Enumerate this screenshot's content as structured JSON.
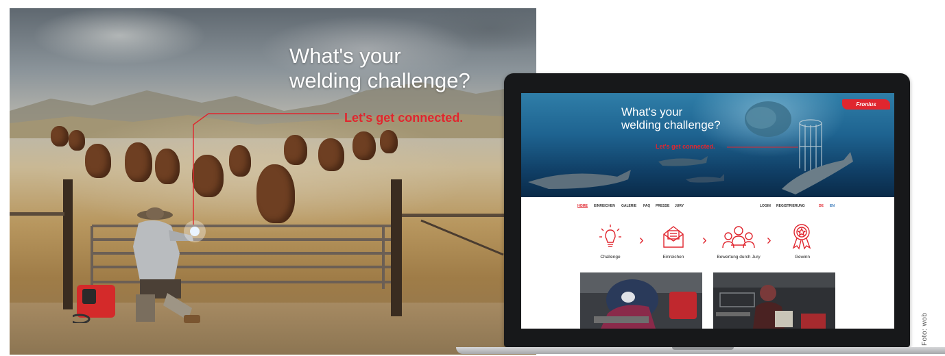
{
  "ad": {
    "headline_line1": "What's your",
    "headline_line2": "welding challenge?",
    "tagline": "Let's get connected."
  },
  "website": {
    "brand": "Fronius",
    "headline_line1": "What's your",
    "headline_line2": "welding challenge?",
    "tagline": "Let's get connected.",
    "nav": {
      "items": [
        "HOME",
        "EINREICHEN",
        "GALERIE",
        "FAQ",
        "PRESSE",
        "JURY"
      ],
      "active": "HOME",
      "login": "LOGIN",
      "register": "REGISTRIERUNG",
      "languages": [
        "DE",
        "EN"
      ],
      "active_language": "DE"
    },
    "steps": [
      {
        "label": "Challenge",
        "icon": "lightbulb-icon"
      },
      {
        "label": "Einreichen",
        "icon": "envelope-icon"
      },
      {
        "label": "Bewertung durch Jury",
        "icon": "jury-group-icon"
      },
      {
        "label": "Gewinn",
        "icon": "award-icon"
      }
    ],
    "step_arrow": "›"
  },
  "photo_credit": "Foto: wob",
  "colors": {
    "brand_red": "#e0262f",
    "laptop_frame": "#17181a",
    "ocean_blue": "#1e6390"
  }
}
